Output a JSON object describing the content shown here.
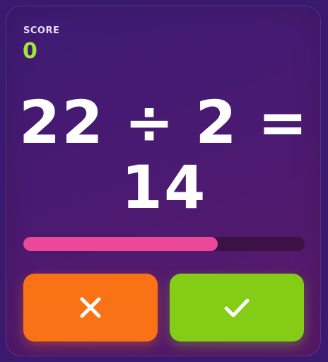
{
  "score": {
    "label": "SCORE",
    "value": "0"
  },
  "question": {
    "operand_a": "22",
    "operator": "÷",
    "operand_b": "2",
    "equals": "=",
    "proposed_answer": "14"
  },
  "timer": {
    "remaining_fraction": 0.69
  },
  "buttons": {
    "wrong": {
      "icon": "close-icon",
      "color": "#f97316"
    },
    "right": {
      "icon": "check-icon",
      "color": "#84cc16"
    }
  },
  "colors": {
    "score_value": "#a3e635",
    "progress_fill": "#ec4899",
    "progress_track": "#3b1146"
  }
}
